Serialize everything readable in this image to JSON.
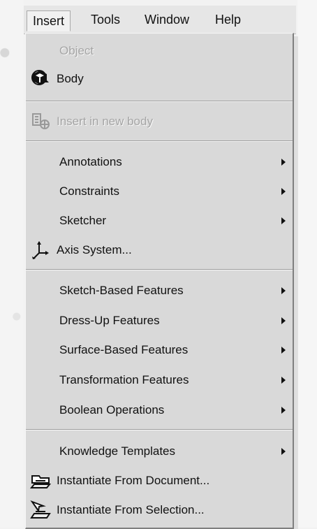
{
  "menubar": {
    "items": [
      {
        "label": "Insert",
        "active": true
      },
      {
        "label": "Tools",
        "active": false
      },
      {
        "label": "Window",
        "active": false
      },
      {
        "label": "Help",
        "active": false
      }
    ]
  },
  "menu": {
    "items": [
      {
        "label": "Object",
        "disabled": true,
        "icon": "none",
        "submenu": false
      },
      {
        "label": "Body",
        "disabled": false,
        "icon": "body-icon",
        "submenu": false
      },
      {
        "label": "Insert in new body",
        "disabled": true,
        "icon": "insert-new-body-icon",
        "submenu": false
      },
      {
        "label": "Annotations",
        "disabled": false,
        "icon": "none",
        "submenu": true
      },
      {
        "label": "Constraints",
        "disabled": false,
        "icon": "none",
        "submenu": true
      },
      {
        "label": "Sketcher",
        "disabled": false,
        "icon": "none",
        "submenu": true
      },
      {
        "label": "Axis System...",
        "disabled": false,
        "icon": "axis-system-icon",
        "submenu": false
      },
      {
        "label": "Sketch-Based Features",
        "disabled": false,
        "icon": "none",
        "submenu": true
      },
      {
        "label": "Dress-Up Features",
        "disabled": false,
        "icon": "none",
        "submenu": true
      },
      {
        "label": "Surface-Based Features",
        "disabled": false,
        "icon": "none",
        "submenu": true
      },
      {
        "label": "Transformation Features",
        "disabled": false,
        "icon": "none",
        "submenu": true
      },
      {
        "label": "Boolean Operations",
        "disabled": false,
        "icon": "none",
        "submenu": true
      },
      {
        "label": "Knowledge Templates",
        "disabled": false,
        "icon": "none",
        "submenu": true
      },
      {
        "label": "Instantiate From Document...",
        "disabled": false,
        "icon": "instantiate-document-icon",
        "submenu": false
      },
      {
        "label": "Instantiate From Selection...",
        "disabled": false,
        "icon": "instantiate-selection-icon",
        "submenu": false
      }
    ]
  },
  "colors": {
    "menu_bg": "#d9d9d9",
    "disabled_text": "#a5a5a5",
    "separator": "#9d9d9d"
  }
}
